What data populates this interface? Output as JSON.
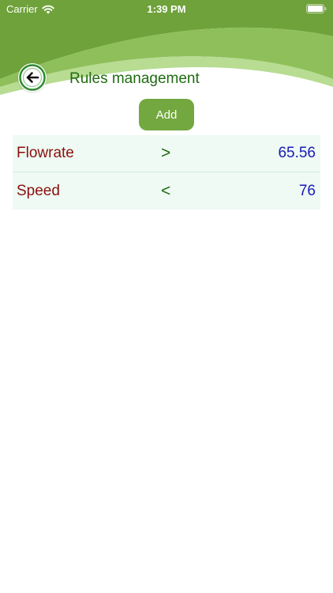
{
  "status_bar": {
    "carrier": "Carrier",
    "time": "1:39 PM",
    "wifi_icon": "wifi-icon",
    "battery_icon": "battery-icon"
  },
  "header": {
    "title": "Rules management",
    "back_icon": "arrow-left-circle-icon"
  },
  "actions": {
    "add_label": "Add"
  },
  "rules": [
    {
      "name": "Flowrate",
      "operator": ">",
      "value": "65.56"
    },
    {
      "name": "Speed",
      "operator": "<",
      "value": "76"
    }
  ],
  "colors": {
    "header_green_dark": "#6fa23a",
    "header_green_light": "#9cc96a",
    "title_green": "#1f6b12",
    "button_green": "#72a83f",
    "rule_name": "#8b1010",
    "rule_value": "#1a1ab8",
    "row_background": "#eefaf3"
  }
}
